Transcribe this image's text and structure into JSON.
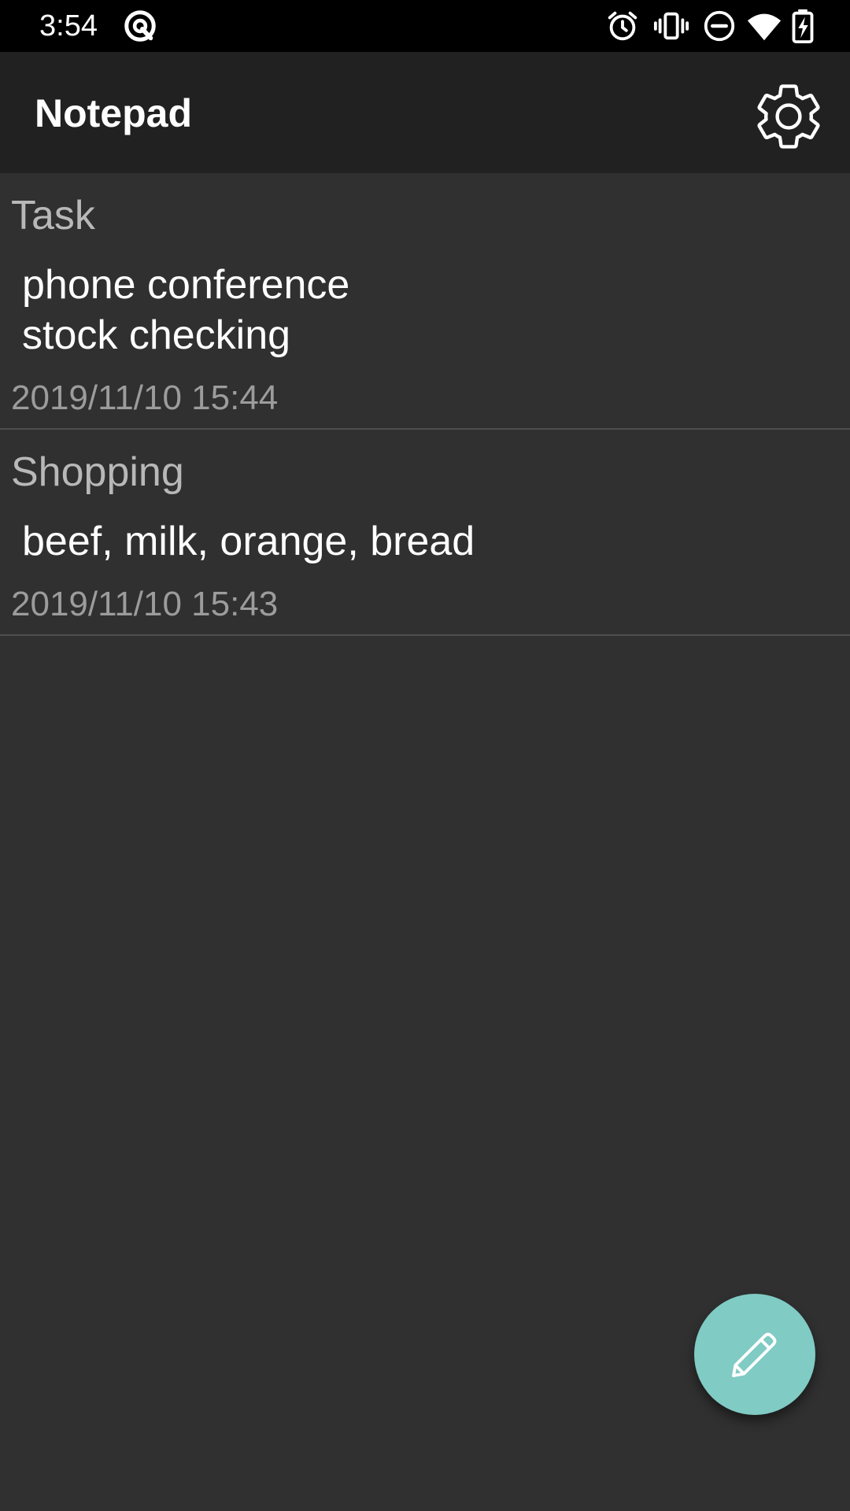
{
  "status_bar": {
    "time": "3:54",
    "icons": [
      "app-notification-icon",
      "alarm-icon",
      "vibrate-icon",
      "do-not-disturb-icon",
      "wifi-icon",
      "battery-charging-icon"
    ]
  },
  "app_bar": {
    "title": "Notepad",
    "settings_icon": "gear-icon"
  },
  "notes": [
    {
      "title": "Task",
      "body": "phone conference\nstock checking",
      "date": "2019/11/10 15:44"
    },
    {
      "title": "Shopping",
      "body": "beef, milk, orange, bread",
      "date": "2019/11/10 15:43"
    }
  ],
  "fab": {
    "icon": "pencil-icon",
    "color": "#80cbc4"
  },
  "colors": {
    "status_bar": "#000000",
    "app_bar": "#212121",
    "background": "#303030",
    "divider": "#4e4e4e"
  }
}
